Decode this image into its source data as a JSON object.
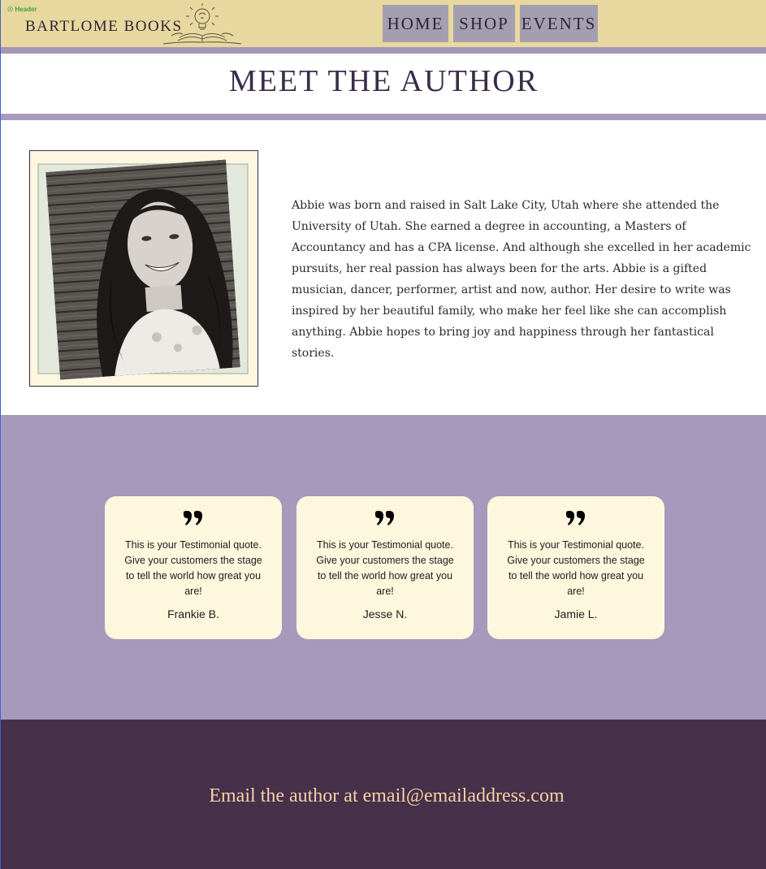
{
  "header": {
    "tag_label": "Header",
    "brand": "BARTLOME BOOKS",
    "nav": [
      {
        "label": "HOME"
      },
      {
        "label": "SHOP"
      },
      {
        "label": "EVENTS"
      }
    ]
  },
  "page": {
    "title": "MEET THE AUTHOR"
  },
  "author": {
    "bio": "Abbie was born and raised in Salt Lake City, Utah where she attended the University of Utah. She earned a degree in accounting, a Masters of Accountancy and has a CPA license. And although she excelled in her academic pursuits, her real passion has always been for the arts. Abbie is a gifted musician, dancer, performer, artist and now, author. Her desire to write was inspired by her beautiful family, who make her feel like she can accomplish anything. Abbie hopes to bring joy and happiness through her fantastical stories."
  },
  "testimonials": [
    {
      "quote": "This is your Testimonial quote. Give your customers the stage to tell the world how great you are!",
      "name": "Frankie B."
    },
    {
      "quote": "This is your Testimonial quote. Give your customers the stage to tell the world how great you are!",
      "name": "Jesse N."
    },
    {
      "quote": "This is your Testimonial quote. Give your customers the stage to tell the world how great you are!",
      "name": "Jamie L."
    }
  ],
  "footer": {
    "email_text": "Email the author at email@emailaddress.com"
  },
  "colors": {
    "header_bg": "#e8d79e",
    "nav_bg": "#a49fae",
    "accent_purple": "#a799bb",
    "footer_bg": "#47304a",
    "card_bg": "#fdf7dd",
    "email_text": "#f4d2a4"
  },
  "icons": {
    "logo": "lightbulb-book-icon",
    "quote": "quote-icon"
  }
}
